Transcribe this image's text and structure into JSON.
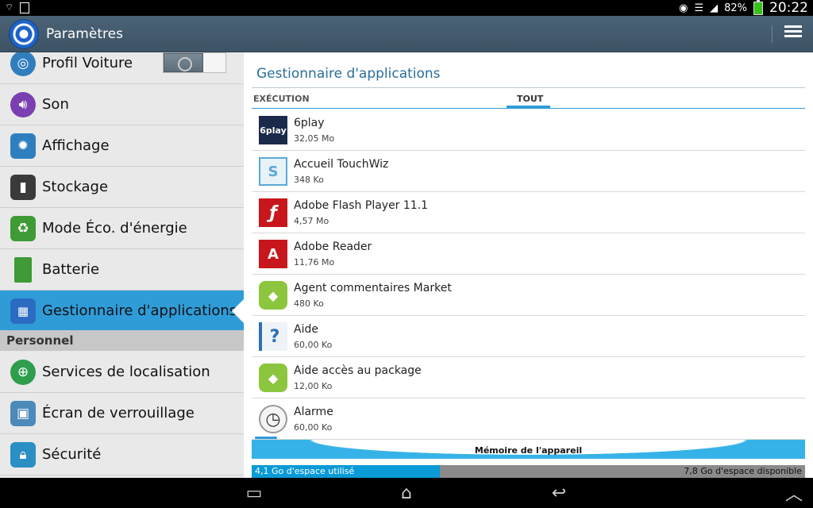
{
  "status_bar": {
    "battery_text": "82%",
    "time": "20:22",
    "icons": [
      "wifi-icon",
      "sim-icon",
      "eye-icon",
      "wifi-signal-icon",
      "cell-signal-icon",
      "battery-icon"
    ]
  },
  "action_bar": {
    "title": "Paramètres",
    "menu_icon": "overflow-menu-icon"
  },
  "sidebar": {
    "items": [
      {
        "label": "Profil Voiture",
        "icon": "steering-wheel-icon",
        "color": "#2f7fbf"
      },
      {
        "label": "Son",
        "icon": "speaker-icon",
        "color": "#7a3fb0"
      },
      {
        "label": "Affichage",
        "icon": "brightness-gear-icon",
        "color": "#2f7fbf"
      },
      {
        "label": "Stockage",
        "icon": "sd-card-icon",
        "color": "#3a3a3a"
      },
      {
        "label": "Mode Éco. d'énergie",
        "icon": "recycle-battery-icon",
        "color": "#3e9b36"
      },
      {
        "label": "Batterie",
        "icon": "battery-icon",
        "color": "#3e9b36"
      },
      {
        "label": "Gestionnaire d'applications",
        "icon": "app-grid-icon",
        "color": "#2b6cc2",
        "selected": true
      }
    ],
    "section_label": "Personnel",
    "personal_items": [
      {
        "label": "Services de localisation",
        "icon": "location-target-icon",
        "color": "#2e9e4d"
      },
      {
        "label": "Écran de verrouillage",
        "icon": "lockscreen-image-icon",
        "color": "#4c8ab9"
      },
      {
        "label": "Sécurité",
        "icon": "padlock-icon",
        "color": "#2b8fc4"
      }
    ]
  },
  "main": {
    "title": "Gestionnaire d'applications",
    "tabs": [
      {
        "label": "EXÉCUTION"
      },
      {
        "label": "TOUT",
        "active": true
      }
    ],
    "apps": [
      {
        "name": "6play",
        "size": "32,05 Mo",
        "icon": "6play-icon",
        "color": "#1b2a4a",
        "glyph": "6play"
      },
      {
        "name": "Accueil TouchWiz",
        "size": "348 Ko",
        "icon": "touchwiz-home-icon",
        "color": "#5aa9d6",
        "glyph": "S"
      },
      {
        "name": "Adobe Flash Player 11.1",
        "size": "4,57 Mo",
        "icon": "adobe-flash-icon",
        "color": "#c8161d",
        "glyph": "ƒ"
      },
      {
        "name": "Adobe Reader",
        "size": "11,76 Mo",
        "icon": "adobe-reader-icon",
        "color": "#c8161d",
        "glyph": "A"
      },
      {
        "name": "Agent commentaires Market",
        "size": "480 Ko",
        "icon": "android-robot-icon",
        "color": "#8cc63f",
        "glyph": "◆"
      },
      {
        "name": "Aide",
        "size": "60,00 Ko",
        "icon": "help-book-icon",
        "color": "#2d6fb5",
        "glyph": "?"
      },
      {
        "name": "Aide accès au package",
        "size": "12,00 Ko",
        "icon": "android-robot-icon",
        "color": "#8cc63f",
        "glyph": "◆"
      },
      {
        "name": "Alarme",
        "size": "60,00 Ko",
        "icon": "alarm-clock-icon",
        "color": "#bdbdbd",
        "glyph": "◷"
      }
    ],
    "storage": {
      "title": "Mémoire de l'appareil",
      "used": "4,1 Go d'espace utilisé",
      "free": "7,8 Go d'espace disponible",
      "used_fraction": 0.34
    }
  },
  "nav_bar": {
    "buttons": [
      "recent-apps-icon",
      "home-icon",
      "back-icon",
      "up-chevron-icon"
    ]
  }
}
